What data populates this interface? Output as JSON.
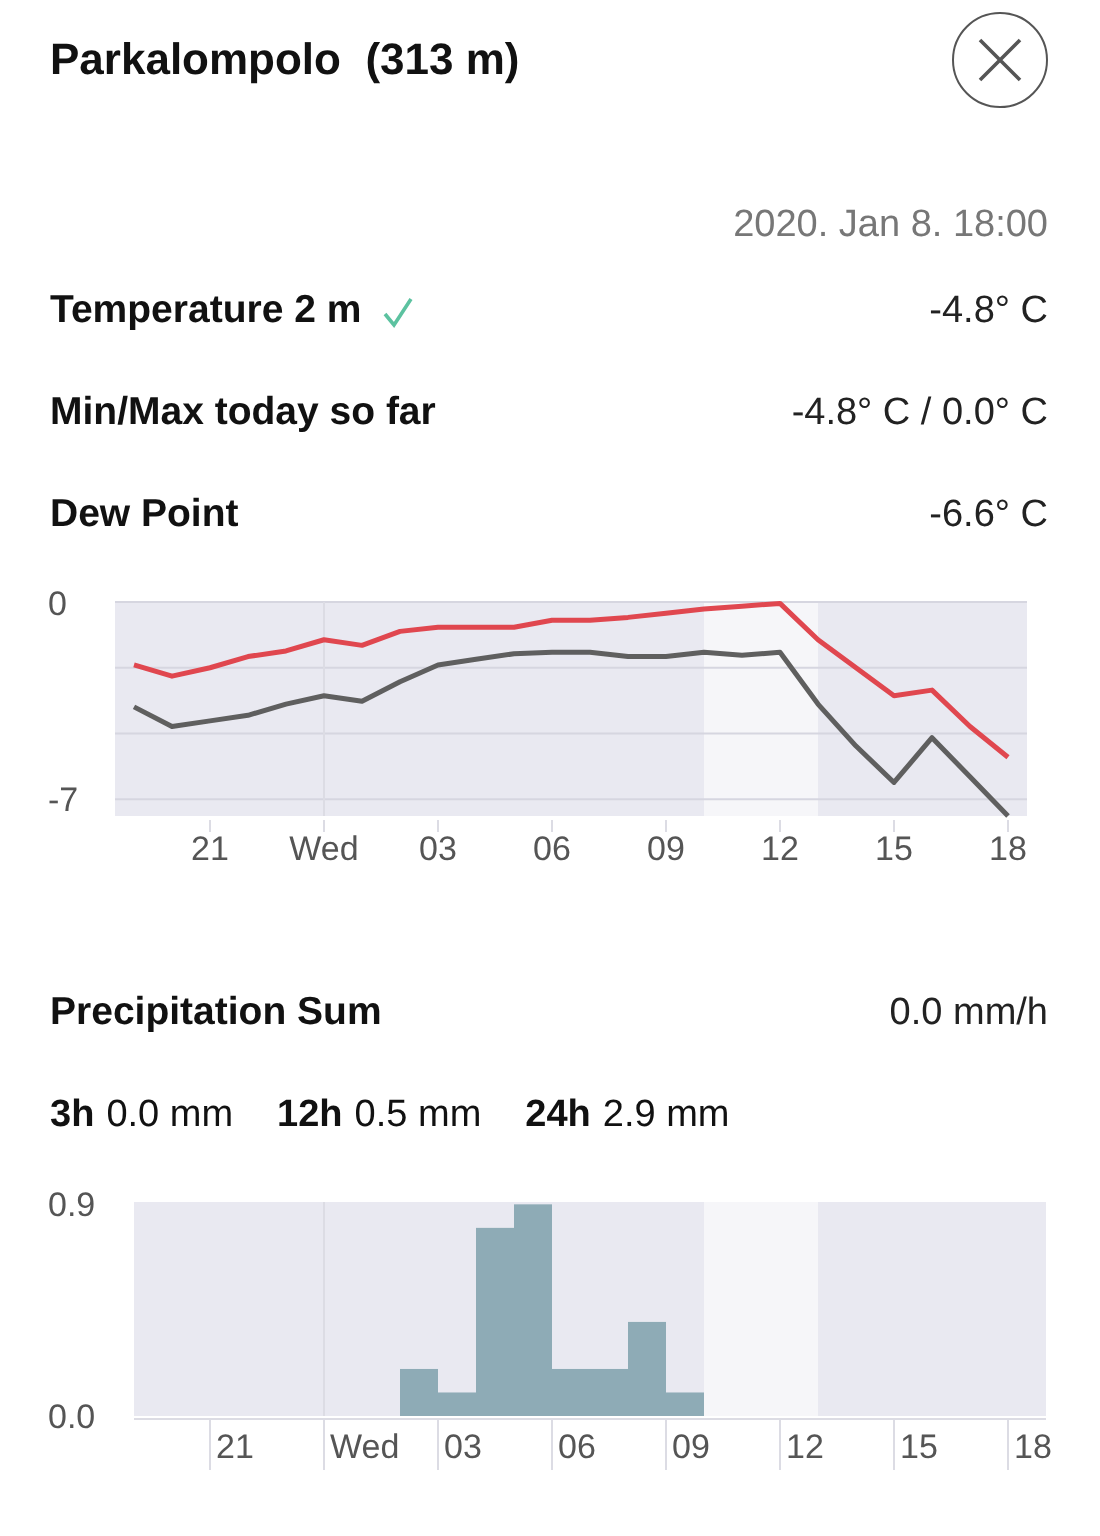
{
  "header": {
    "title": "Parkalompolo  (313 m)"
  },
  "timestamp": "2020. Jan 8. 18:00",
  "readings": [
    {
      "label": "Temperature 2 m",
      "verified": true,
      "value": "-4.8° C"
    },
    {
      "label": "Min/Max today so far",
      "verified": false,
      "value": "-4.8° C / 0.0° C"
    },
    {
      "label": "Dew Point",
      "verified": false,
      "value": "-6.6° C"
    }
  ],
  "temperature_chart": {
    "chart_data": {
      "type": "line",
      "categories": [
        null,
        null,
        "21",
        null,
        null,
        "Wed",
        null,
        null,
        "03",
        null,
        null,
        "06",
        null,
        null,
        "09",
        null,
        null,
        "12",
        null,
        null,
        "15",
        null,
        null,
        "18"
      ],
      "series": [
        {
          "color": "#e0474f",
          "values": [
            -2.2,
            -2.6,
            -2.3,
            -1.9,
            -1.7,
            -1.3,
            -1.5,
            -1.0,
            -0.85,
            -0.85,
            -0.85,
            -0.6,
            -0.6,
            -0.5,
            -0.35,
            -0.2,
            -0.1,
            0.0,
            -1.3,
            -2.3,
            -3.3,
            -3.1,
            -4.4,
            -5.5
          ]
        },
        {
          "color": "#5f5f5f",
          "values": [
            -3.7,
            -4.4,
            -4.2,
            -4.0,
            -3.6,
            -3.3,
            -3.5,
            -2.8,
            -2.2,
            -2.0,
            -1.8,
            -1.75,
            -1.75,
            -1.9,
            -1.9,
            -1.75,
            -1.85,
            -1.75,
            -3.6,
            -5.1,
            -6.4,
            -4.8,
            -6.2,
            -7.6
          ]
        }
      ],
      "ylim": [
        -7.6,
        0.05
      ],
      "yticks": [
        0,
        -7
      ]
    }
  },
  "precipitation": {
    "label": "Precipitation Sum",
    "value": "0.0 mm/h",
    "sums": [
      {
        "period": "3h",
        "amount": "0.0 mm"
      },
      {
        "period": "12h",
        "amount": "0.5 mm"
      },
      {
        "period": "24h",
        "amount": "2.9 mm"
      }
    ],
    "chart_data": {
      "type": "bar",
      "categories": [
        null,
        null,
        "21",
        null,
        null,
        "Wed",
        null,
        null,
        "03",
        null,
        null,
        "06",
        null,
        null,
        "09",
        null,
        null,
        "12",
        null,
        null,
        "15",
        null,
        null,
        "18"
      ],
      "values": [
        0,
        0,
        0,
        0,
        0,
        0,
        0,
        0.2,
        0.1,
        0.8,
        0.9,
        0.2,
        0.2,
        0.4,
        0.1,
        0,
        0,
        0,
        0,
        0,
        0,
        0,
        0,
        0
      ],
      "color": "#8eabb6",
      "ylim": [
        0,
        0.91
      ],
      "yticks": [
        {
          "value": 0.9,
          "label": "0.9"
        },
        {
          "value": 0,
          "label": "0.0"
        }
      ]
    }
  }
}
